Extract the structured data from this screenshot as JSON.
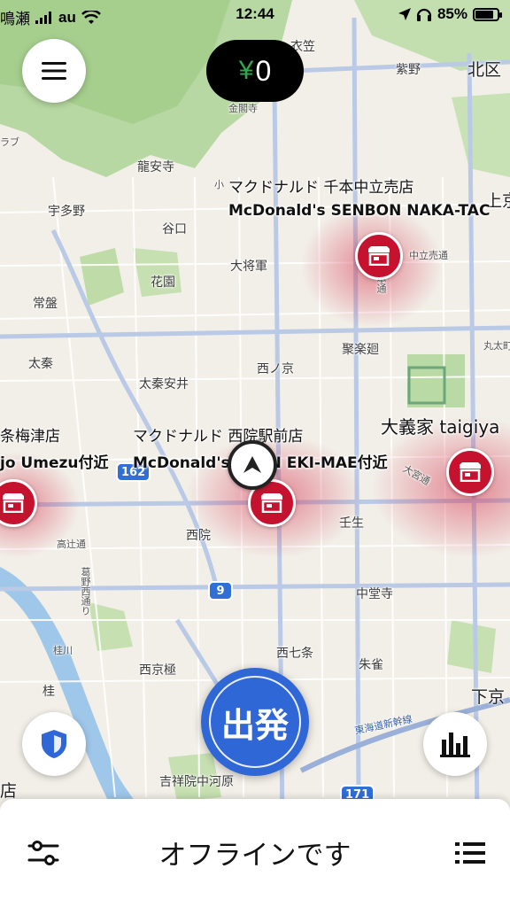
{
  "status_bar": {
    "carrier_prefix": "鳴瀬",
    "carrier": "au",
    "time": "12:44",
    "battery": "85%",
    "battery_level": 0.85
  },
  "header": {
    "earnings_currency": "¥",
    "earnings_amount": "0"
  },
  "map": {
    "labels": [
      "衣笠",
      "金閣寺",
      "紫野",
      "北区",
      "龍安寺",
      "宇多野",
      "谷口",
      "大将軍",
      "花園",
      "常盤",
      "太秦",
      "太秦安井",
      "西ノ京",
      "聚楽廻",
      "西院",
      "壬生",
      "中堂寺",
      "桂川",
      "西京極",
      "西七条",
      "朱雀",
      "桂",
      "下京",
      "吉祥院中河原",
      "ラブ",
      "小",
      "上京",
      "丸太町",
      "店"
    ],
    "road_labels": [
      "千本通",
      "中立売通",
      "高辻通",
      "葛野西通り",
      "東海道新幹線",
      "大宮通"
    ],
    "route_shields": [
      "162",
      "9",
      "171"
    ],
    "places": [
      {
        "name_ja": "マクドナルド 千本中立売店",
        "name_en": "McDonald's SENBON NAKA-TAC"
      },
      {
        "name_ja": "マクドナルド 西院駅前店",
        "name_en": "McDonald's SAIIN EKI-MAE付近"
      },
      {
        "name_ja": "大義家 taigiya",
        "name_en": ""
      },
      {
        "name_ja": "条梅津店",
        "name_en": "jo Umezu付近"
      }
    ]
  },
  "go_button": {
    "label": "出発"
  },
  "bottom_sheet": {
    "status": "オフラインです"
  },
  "colors": {
    "accent_blue": "#2f67d6",
    "hotspot_red": "#c4122f",
    "earnings_green": "#2fa84f"
  }
}
